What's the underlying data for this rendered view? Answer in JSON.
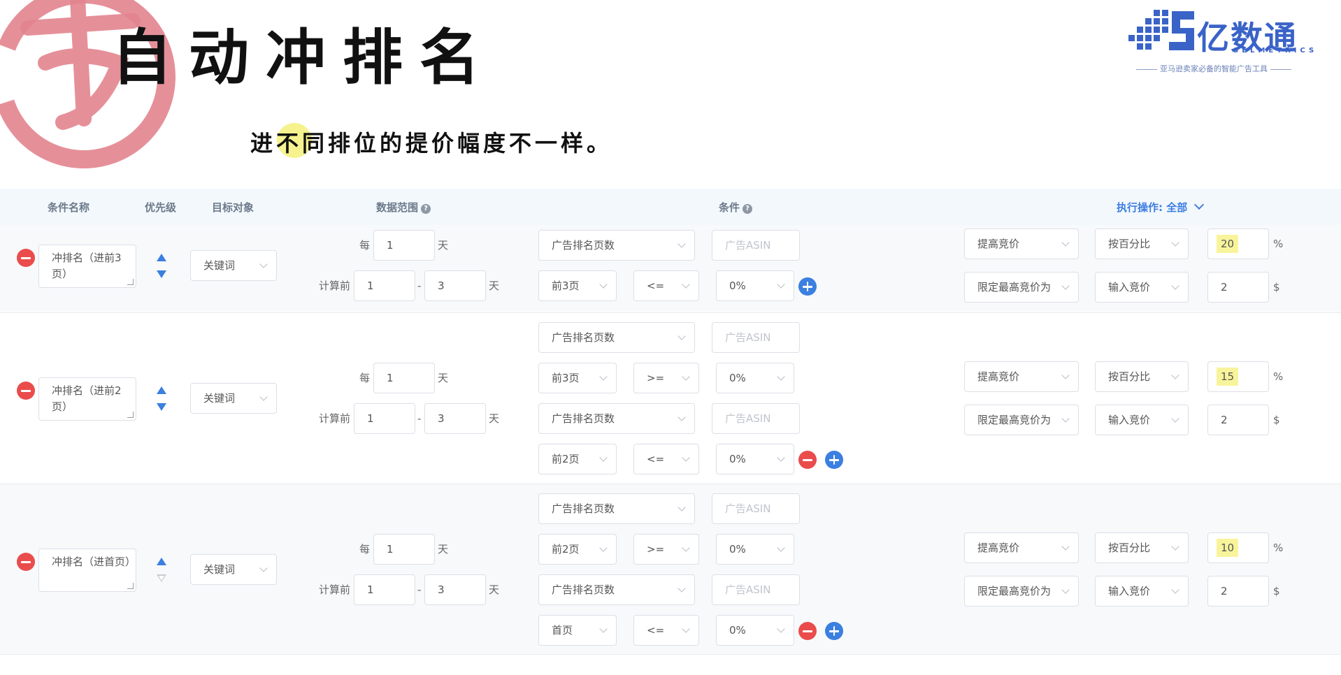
{
  "header": {
    "title": "自动冲排名",
    "subtitle": "进不同排位的提价幅度不一样。"
  },
  "logo": {
    "name_cn": "亿数通",
    "name_en": "SELMETRICS",
    "slogan": "亚马逊卖家必备的智能广告工具"
  },
  "table_header": {
    "condition_name": "条件名称",
    "priority": "优先级",
    "target": "目标对象",
    "data_range": "数据范围",
    "condition": "条件",
    "action_label": "执行操作:",
    "action_value": "全部"
  },
  "rows": [
    {
      "name": "冲排名（进前3页）",
      "target": "关键词",
      "every_prefix": "每",
      "every_value": "1",
      "every_unit": "天",
      "calc_prefix": "计算前",
      "calc_from": "1",
      "calc_sep": "-",
      "calc_to": "3",
      "calc_unit": "天",
      "conditions": [
        {
          "metric": "广告排名页数",
          "asin_placeholder": "广告ASIN",
          "page": "前3页",
          "op": "<=",
          "pct": "0%"
        }
      ],
      "action_main": "提高竞价",
      "action_mode": "按百分比",
      "action_value": "20",
      "action_unit": "%",
      "limit_label": "限定最高竞价为",
      "limit_mode": "输入竞价",
      "limit_value": "2",
      "limit_unit": "$"
    },
    {
      "name": "冲排名（进前2页）",
      "target": "关键词",
      "every_prefix": "每",
      "every_value": "1",
      "every_unit": "天",
      "calc_prefix": "计算前",
      "calc_from": "1",
      "calc_sep": "-",
      "calc_to": "3",
      "calc_unit": "天",
      "conditions": [
        {
          "metric": "广告排名页数",
          "asin_placeholder": "广告ASIN",
          "page": "前3页",
          "op": ">=",
          "pct": "0%"
        },
        {
          "metric": "广告排名页数",
          "asin_placeholder": "广告ASIN",
          "page": "前2页",
          "op": "<=",
          "pct": "0%"
        }
      ],
      "action_main": "提高竞价",
      "action_mode": "按百分比",
      "action_value": "15",
      "action_unit": "%",
      "limit_label": "限定最高竞价为",
      "limit_mode": "输入竞价",
      "limit_value": "2",
      "limit_unit": "$"
    },
    {
      "name": "冲排名（进首页）",
      "target": "关键词",
      "every_prefix": "每",
      "every_value": "1",
      "every_unit": "天",
      "calc_prefix": "计算前",
      "calc_from": "1",
      "calc_sep": "-",
      "calc_to": "3",
      "calc_unit": "天",
      "conditions": [
        {
          "metric": "广告排名页数",
          "asin_placeholder": "广告ASIN",
          "page": "前2页",
          "op": ">=",
          "pct": "0%"
        },
        {
          "metric": "广告排名页数",
          "asin_placeholder": "广告ASIN",
          "page": "首页",
          "op": "<=",
          "pct": "0%"
        }
      ],
      "action_main": "提高竞价",
      "action_mode": "按百分比",
      "action_value": "10",
      "action_unit": "%",
      "limit_label": "限定最高竞价为",
      "limit_mode": "输入竞价",
      "limit_value": "2",
      "limit_unit": "$"
    }
  ],
  "colors": {
    "accent": "#3b7fe0",
    "danger": "#ea4c4c",
    "highlight": "#f8f49b",
    "seal": "#e2848e"
  }
}
